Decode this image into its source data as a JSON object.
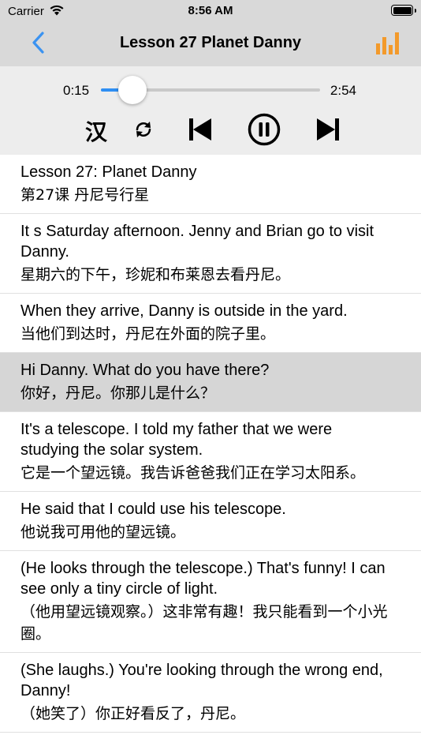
{
  "status_bar": {
    "carrier": "Carrier",
    "time": "8:56 AM",
    "wifi_icon": "wifi-icon",
    "battery_icon": "battery-icon"
  },
  "nav": {
    "title": "Lesson 27 Planet Danny",
    "back_icon": "chevron-left-icon",
    "chart_icon": "bar-chart-icon",
    "accent_color": "#3b93f1",
    "chart_color": "#f39a2b"
  },
  "player": {
    "elapsed": "0:15",
    "total": "2:54",
    "progress": 0.144,
    "language_toggle_label": "汉",
    "repeat_icon": "repeat-icon",
    "previous_icon": "skip-previous-icon",
    "pause_icon": "pause-circle-icon",
    "next_icon": "skip-next-icon"
  },
  "sentences": [
    {
      "en": "Lesson 27: Planet Danny",
      "zh": "第27课 丹尼号行星",
      "selected": false
    },
    {
      "en": "It s Saturday afternoon. Jenny and Brian go to visit Danny.",
      "zh": "星期六的下午，珍妮和布莱恩去看丹尼。",
      "selected": false
    },
    {
      "en": "When they arrive, Danny is outside in the yard.",
      "zh": "当他们到达时，丹尼在外面的院子里。",
      "selected": false
    },
    {
      "en": "Hi Danny. What do you have there?",
      "zh": "你好，丹尼。你那儿是什么？",
      "selected": true
    },
    {
      "en": "It's a telescope. I told my father that we were studying the solar system.",
      "zh": "它是一个望远镜。我告诉爸爸我们正在学习太阳系。",
      "selected": false
    },
    {
      "en": "He said that I could use his telescope.",
      "zh": "他说我可用他的望远镜。",
      "selected": false
    },
    {
      "en": "(He looks through the telescope.) That's funny! I can see only a tiny circle of light.",
      "zh": "（他用望远镜观察。）这非常有趣！我只能看到一个小光圈。",
      "selected": false
    },
    {
      "en": "(She laughs.) You're looking through the wrong end, Danny!",
      "zh": "（她笑了）你正好看反了，丹尼。",
      "selected": false
    }
  ]
}
